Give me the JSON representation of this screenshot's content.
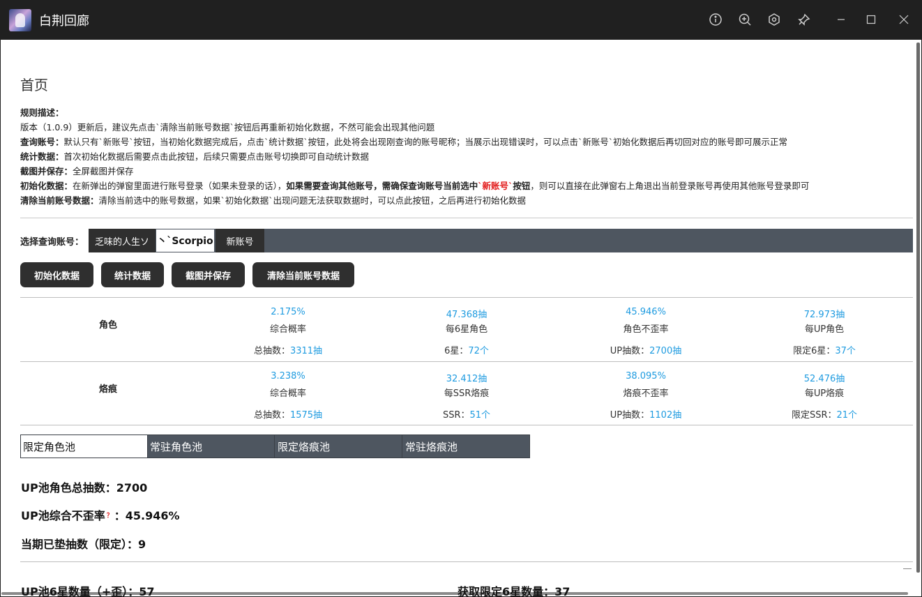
{
  "window": {
    "title": "白荆回廊",
    "controls": [
      "info-icon",
      "zoom-in-icon",
      "settings-icon",
      "pin-icon",
      "minimize-icon",
      "maximize-icon",
      "close-icon"
    ]
  },
  "page": {
    "title": "首页"
  },
  "rules": {
    "heading": "规则描述：",
    "version_note": "版本（1.0.9）更新后，建议先点击`清除当前账号数据`按钮后再重新初始化数据，不然可能会出现其他问题",
    "query_label": "查询账号：",
    "query_text": "默认只有`新账号`按钮，当初始化数据完成后，点击`统计数据`按钮，此处将会出现刚查询的账号昵称；当展示出现错误时，可以点击`新账号`初始化数据后再切回对应的账号即可展示正常",
    "stats_label": "统计数据：",
    "stats_text": "首次初始化数据后需要点击此按钮，后续只需要点击账号切换即可自动统计数据",
    "screenshot_label": "截图并保存：",
    "screenshot_text": "全屏截图并保存",
    "init_label": "初始化数据：",
    "init_text": "在新弹出的弹窗里面进行账号登录（如果未登录的话），",
    "init_bold_1": "如果需要查询其他账号，需确保查询账号当前选中",
    "init_red": "`新账号`",
    "init_bold_2": "按钮",
    "init_text_2": "，则可以直接在此弹窗右上角退出当前登录账号再使用其他账号登录即可",
    "clear_label": "清除当前账号数据：",
    "clear_text": "清除当前选中的账号数据，如果`初始化数据`出现问题无法获取数据时，可以点此按钮，之后再进行初始化数据"
  },
  "account": {
    "label": "选择查询账号：",
    "tabs": [
      "乏味的人生ソ",
      "丶`Scorpio",
      "新账号"
    ],
    "active_index": 1
  },
  "actions": {
    "init": "初始化数据",
    "stats": "统计数据",
    "screenshot": "截图并保存",
    "clear": "清除当前账号数据"
  },
  "stats": {
    "character": {
      "label": "角色",
      "cells": [
        {
          "value": "2.175%",
          "label": "综合概率",
          "total_label": "总抽数：",
          "total_value": "3311抽"
        },
        {
          "value": "47.368抽",
          "label": "每6星角色",
          "total_label": "6星：",
          "total_value": "72个"
        },
        {
          "value": "45.946%",
          "label": "角色不歪率",
          "total_label": "UP抽数：",
          "total_value": "2700抽"
        },
        {
          "value": "72.973抽",
          "label": "每UP角色",
          "total_label": "限定6星：",
          "total_value": "37个"
        }
      ]
    },
    "imprint": {
      "label": "烙痕",
      "cells": [
        {
          "value": "3.238%",
          "label": "综合概率",
          "total_label": "总抽数：",
          "total_value": "1575抽"
        },
        {
          "value": "32.412抽",
          "label": "每SSR烙痕",
          "total_label": "SSR：",
          "total_value": "51个"
        },
        {
          "value": "38.095%",
          "label": "烙痕不歪率",
          "total_label": "UP抽数：",
          "total_value": "1102抽"
        },
        {
          "value": "52.476抽",
          "label": "每UP烙痕",
          "total_label": "限定SSR：",
          "total_value": "21个"
        }
      ]
    }
  },
  "pools": {
    "tabs": [
      "限定角色池",
      "常驻角色池",
      "限定烙痕池",
      "常驻烙痕池"
    ],
    "active_index": 0
  },
  "summary": {
    "total_label": "UP池角色总抽数：",
    "total_value": "2700",
    "rate_label": "UP池综合不歪率",
    "rate_hint": "？",
    "rate_sep": "：",
    "rate_value": "45.946%",
    "pity_label": "当期已垫抽数（限定）：",
    "pity_value": "9",
    "six_star_label": "UP池6星数量（+歪）：",
    "six_star_value": "57",
    "limited_label": "获取限定6星数量：",
    "limited_value": "37"
  },
  "colors": {
    "accent_value": "#1e9be0",
    "highlight_red": "#e21b1b",
    "dark_button": "#2f2f2f",
    "tab_bar": "#4e5660",
    "titlebar": "#202020"
  }
}
